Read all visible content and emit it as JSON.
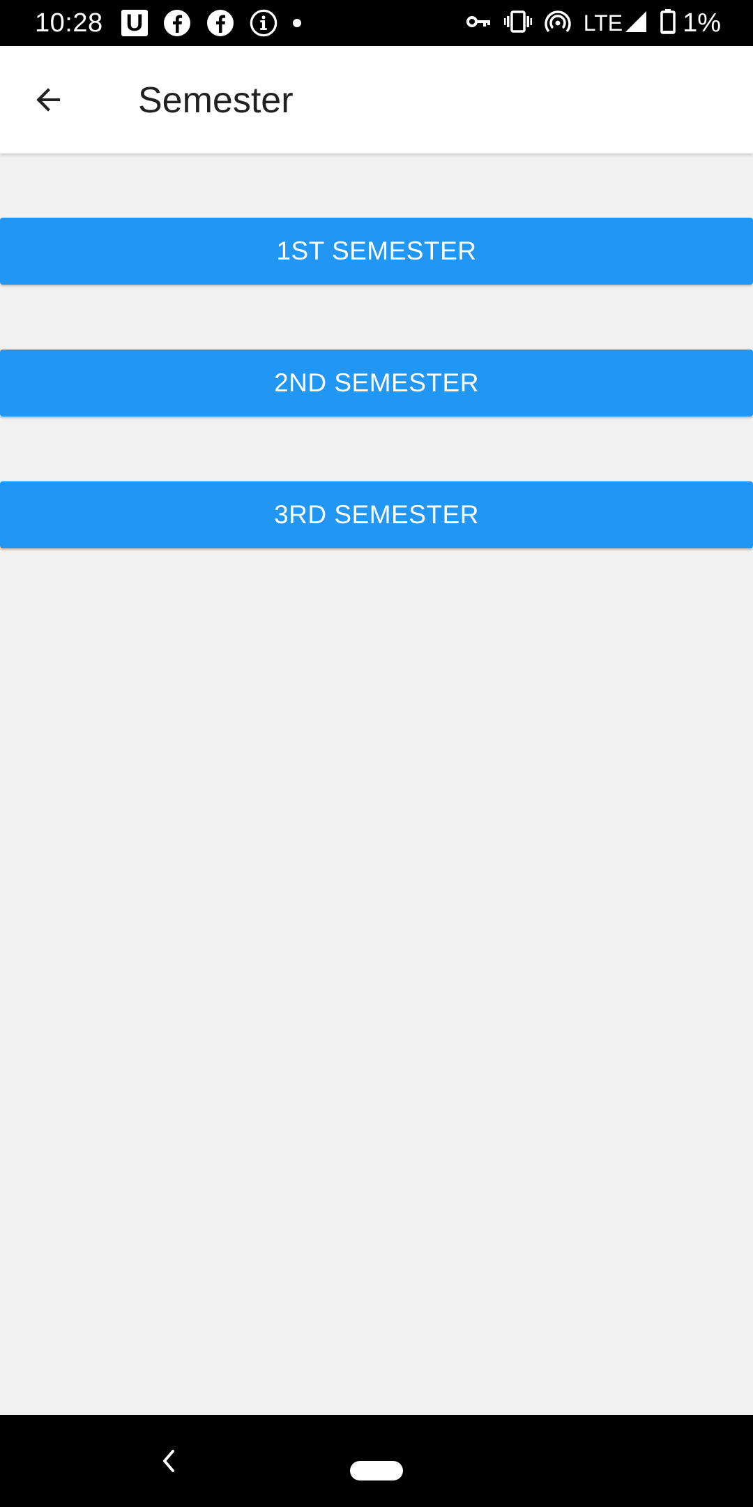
{
  "status_bar": {
    "time": "10:28",
    "left_icons": [
      "u-app-icon",
      "facebook-icon",
      "facebook-icon",
      "info-icon",
      "notification-dot-icon"
    ],
    "right_icons": [
      "vpn-key-icon",
      "vibrate-icon",
      "hotspot-icon",
      "signal-icon",
      "battery-icon"
    ],
    "u_label": "U",
    "network": "LTE",
    "battery": "1%"
  },
  "app_bar": {
    "title": "Semester",
    "back_icon": "arrow-back-icon"
  },
  "semesters": [
    {
      "label": "1ST SEMESTER"
    },
    {
      "label": "2ND SEMESTER"
    },
    {
      "label": "3RD SEMESTER"
    }
  ],
  "nav_bar": {
    "back_icon": "chevron-left-icon",
    "home_icon": "home-pill-icon"
  },
  "colors": {
    "accent": "#2196f3",
    "background": "#f1f1f1",
    "app_bar": "#ffffff",
    "status_bar": "#000000",
    "title_text": "#212121",
    "button_text": "#ffffff"
  }
}
